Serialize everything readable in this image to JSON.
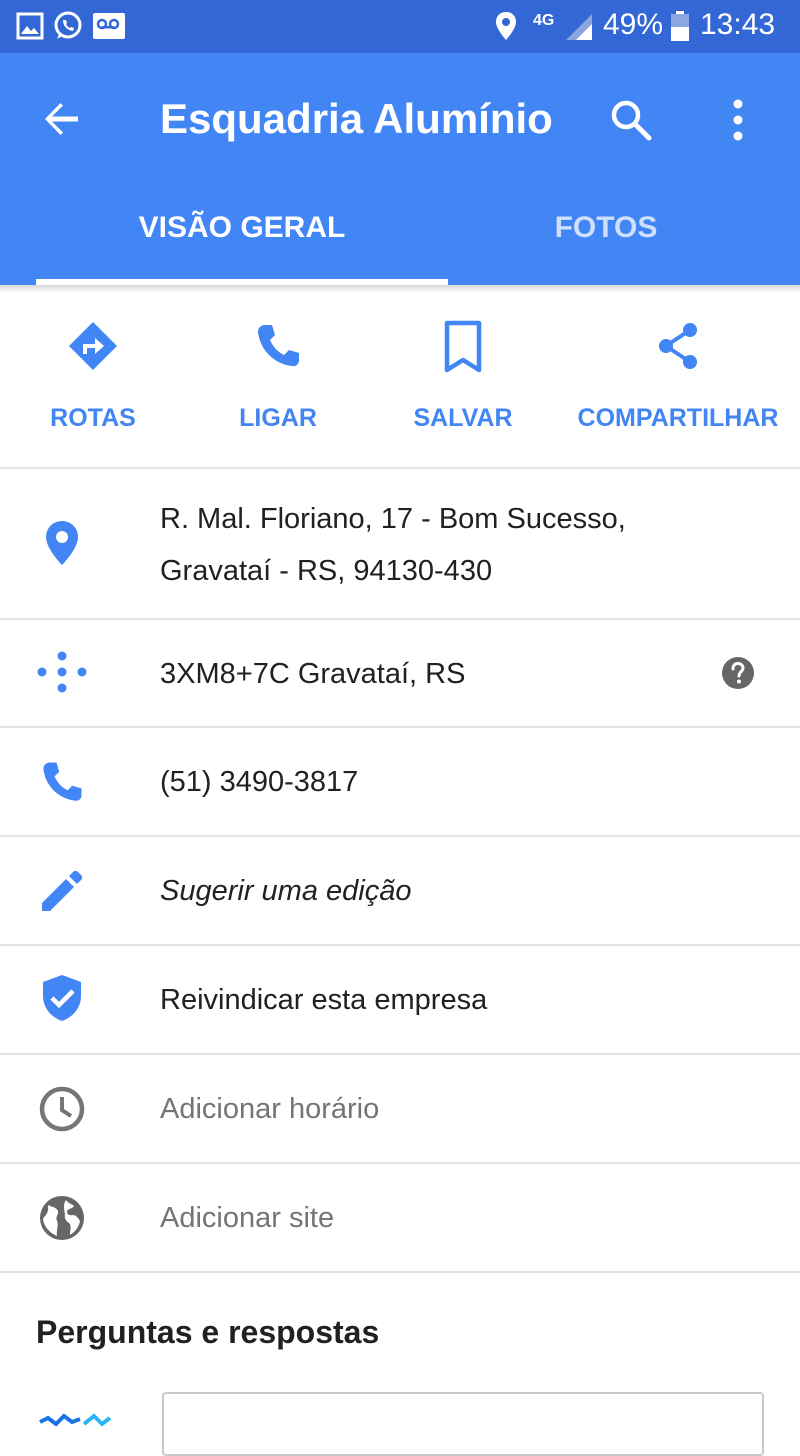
{
  "status_bar": {
    "battery": "49%",
    "time": "13:43",
    "network": "4G",
    "icons": [
      "gallery-icon",
      "whatsapp-icon",
      "voicemail-icon",
      "location-icon",
      "signal-icon",
      "battery-icon"
    ]
  },
  "app_bar": {
    "title": "Esquadria Alumínio",
    "tabs": [
      {
        "label": "VISÃO GERAL",
        "selected": true
      },
      {
        "label": "FOTOS",
        "selected": false
      }
    ],
    "icons": [
      "back-arrow-icon",
      "search-icon",
      "more-vert-icon"
    ]
  },
  "actions": [
    {
      "label": "ROTAS",
      "icon": "directions-icon"
    },
    {
      "label": "LIGAR",
      "icon": "phone-icon"
    },
    {
      "label": "SALVAR",
      "icon": "bookmark-icon"
    },
    {
      "label": "COMPARTILHAR",
      "icon": "share-icon"
    }
  ],
  "info": {
    "address_line1": "R. Mal. Floriano, 17 - Bom Sucesso,",
    "address_line2": "Gravataí - RS, 94130-430",
    "plus_code": "3XM8+7C Gravataí, RS",
    "phone": "(51) 3490-3817",
    "suggest_edit": "Sugerir uma edição",
    "claim_business": "Reivindicar esta empresa",
    "add_hours": "Adicionar horário",
    "add_site": "Adicionar site"
  },
  "qa": {
    "title": "Perguntas e respostas"
  },
  "colors": {
    "status_bar": "#3367d6",
    "app_bar": "#4285f4",
    "accent": "#4285f4",
    "text_primary": "#212121",
    "text_secondary": "#757575"
  }
}
